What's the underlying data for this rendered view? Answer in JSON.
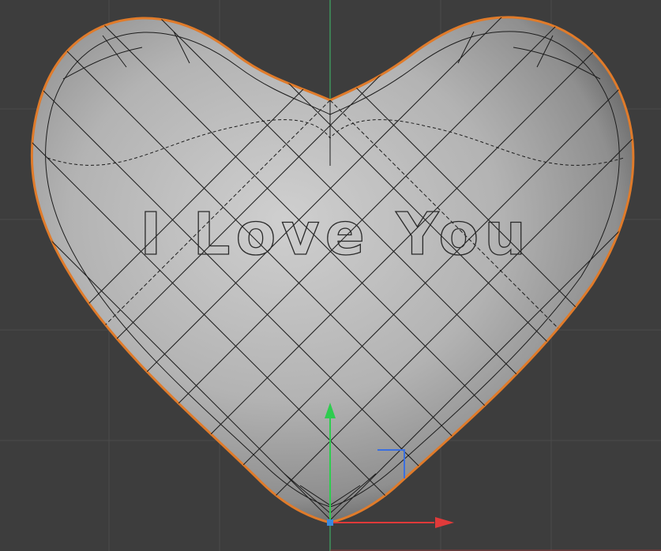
{
  "viewport": {
    "mode": "3d-edit",
    "background": "#3d3d3d",
    "grid_color": "#4a4a4a",
    "y_axis_line_color": "#3fbf6a",
    "x_axis_line_color": "#8a3a3a"
  },
  "object": {
    "type": "heart-mesh",
    "selected": true,
    "outline_color": "#e07b2a",
    "wire_color": "#1c1c1c",
    "shade_light": "#c4c4c4",
    "shade_dark": "#8a8a8a"
  },
  "text": {
    "label": "I Love You",
    "outline_color": "#2a2a2a"
  },
  "gizmo": {
    "y_arrow_color": "#2ecc4f",
    "x_arrow_color": "#e03a3a",
    "z_corner_color": "#3a6fe0",
    "pivot_color": "#3a8ae0"
  }
}
